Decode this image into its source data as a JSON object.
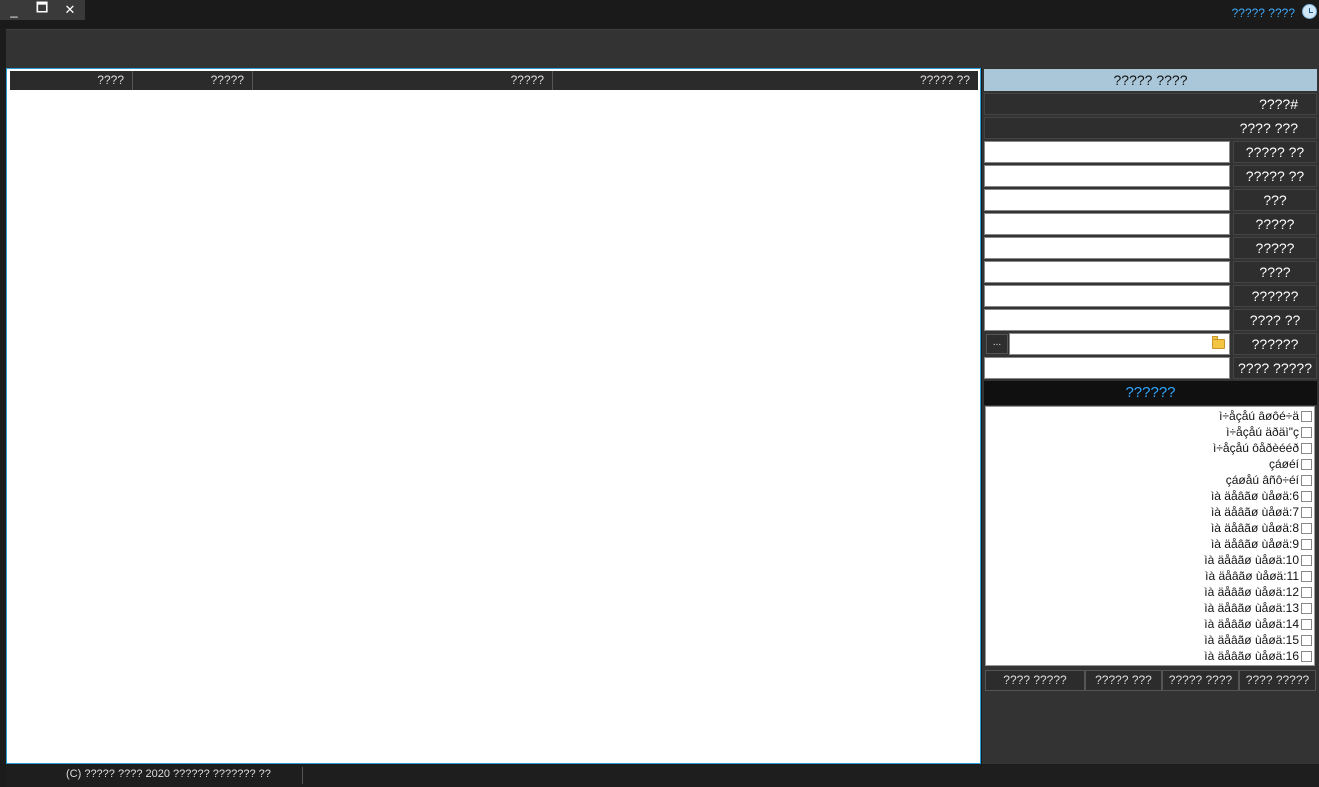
{
  "window": {
    "title_link": "????? ????",
    "controls": {
      "minimize": "_",
      "maximize": "🗖",
      "close": "✕"
    },
    "clock_icon": "clock-icon"
  },
  "table": {
    "columns": [
      "????",
      "?????",
      "?????",
      "????? ??"
    ]
  },
  "panel": {
    "header": "????? ????",
    "id_label": "????#",
    "date_label": "???? ???",
    "fields": [
      {
        "label": "????? ??",
        "value": ""
      },
      {
        "label": "????? ??",
        "value": ""
      },
      {
        "label": "???",
        "value": ""
      },
      {
        "label": "?????",
        "value": ""
      },
      {
        "label": "?????",
        "value": ""
      },
      {
        "label": "????",
        "value": ""
      },
      {
        "label": "??????",
        "value": ""
      },
      {
        "label": "???? ??",
        "value": ""
      }
    ],
    "file": {
      "label": "??????",
      "browse": "...",
      "value": ""
    },
    "last_field": {
      "label": "???? ?????",
      "value": ""
    },
    "section_header": "??????",
    "checklist": [
      "ì÷åçåú âøôé÷ä",
      "ì÷åçåú äðäì\"ç",
      "ì÷åçåú ôåðèééð",
      "çáøéí",
      "çáøåú âñô÷éí",
      "ìà äåâãø ùåøä:6",
      "ìà äåâãø ùåøä:7",
      "ìà äåâãø ùåøä:8",
      "ìà äåâãø ùåøä:9",
      "ìà äåâãø ùåøä:10",
      "ìà äåâãø ùåøä:11",
      "ìà äåâãø ùåøä:12",
      "ìà äåâãø ùåøä:13",
      "ìà äåâãø ùåøä:14",
      "ìà äåâãø ùåøä:15",
      "ìà äåâãø ùåøä:16"
    ],
    "actions": [
      "???? ?????",
      "????? ???",
      "????? ????",
      "???? ?????"
    ]
  },
  "status": {
    "copyright": "(C) ????? ???? 2020 ?????? ??????? ??"
  }
}
